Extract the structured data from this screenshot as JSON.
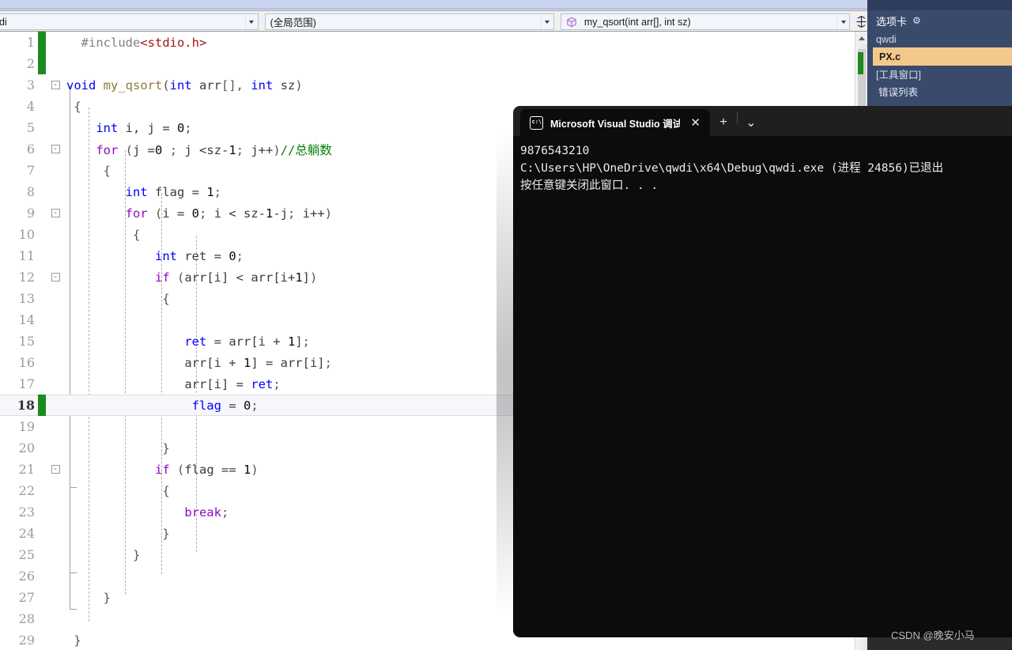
{
  "navbar": {
    "project_combo": {
      "value": "di",
      "arrow_icon": "chevron-down-icon"
    },
    "scope_combo": {
      "value": "(全局范围)",
      "arrow_icon": "chevron-down-icon"
    },
    "member_combo": {
      "value": "my_qsort(int arr[], int sz)",
      "icon": "cube-icon",
      "arrow_icon": "chevron-down-icon"
    },
    "splitter_icon": "split-window-icon"
  },
  "editor": {
    "current_line": 18,
    "lines": [
      {
        "n": "1",
        "fold": "",
        "change": "green",
        "html": "  <span class='pp'>#include</span><span class='str'>&lt;stdio.h&gt;</span>"
      },
      {
        "n": "2",
        "fold": "",
        "change": "green",
        "html": ""
      },
      {
        "n": "3",
        "fold": "-",
        "change": "",
        "html": "<span class='kw'>void</span> <span class='fn'>my_qsort</span><span class='punc'>(</span><span class='kw'>int</span> <span class='plain'>arr</span><span class='punc'>[], </span><span class='kw'>int</span> <span class='plain'>sz</span><span class='punc'>)</span>"
      },
      {
        "n": "4",
        "fold": "",
        "change": "",
        "html": " <span class='punc'>{</span>"
      },
      {
        "n": "5",
        "fold": "",
        "change": "",
        "html": "    <span class='kw'>int</span> <span class='plain'>i, j = </span><span class='num'>0</span><span class='punc'>;</span>"
      },
      {
        "n": "6",
        "fold": "-",
        "change": "",
        "html": "    <span class='kw2'>for</span> <span class='punc'>(</span><span class='plain'>j =</span><span class='num'>0</span> <span class='punc'>; </span><span class='plain'>j &lt;sz-</span><span class='num'>1</span><span class='punc'>; </span><span class='plain'>j++</span><span class='punc'>)</span><span class='cmt'>//总躺数</span>"
      },
      {
        "n": "7",
        "fold": "",
        "change": "",
        "html": "     <span class='punc'>{</span>"
      },
      {
        "n": "8",
        "fold": "",
        "change": "",
        "html": "        <span class='kw'>int</span> <span class='plain'>flag = </span><span class='num'>1</span><span class='punc'>;</span>"
      },
      {
        "n": "9",
        "fold": "-",
        "change": "",
        "html": "        <span class='kw2'>for</span> <span class='punc'>(</span><span class='plain'>i = </span><span class='num'>0</span><span class='punc'>; </span><span class='plain'>i &lt; sz-</span><span class='num'>1</span><span class='plain'>-j</span><span class='punc'>; </span><span class='plain'>i++</span><span class='punc'>)</span>"
      },
      {
        "n": "10",
        "fold": "",
        "change": "",
        "html": "         <span class='punc'>{</span>"
      },
      {
        "n": "11",
        "fold": "",
        "change": "",
        "html": "            <span class='kw'>int</span> <span class='plain'>ret = </span><span class='num'>0</span><span class='punc'>;</span>"
      },
      {
        "n": "12",
        "fold": "-",
        "change": "",
        "html": "            <span class='kw2'>if</span> <span class='punc'>(</span><span class='plain'>arr[i] &lt; arr[i+</span><span class='num'>1</span><span class='plain'>]</span><span class='punc'>)</span>"
      },
      {
        "n": "13",
        "fold": "",
        "change": "",
        "html": "             <span class='punc'>{</span>"
      },
      {
        "n": "14",
        "fold": "",
        "change": "",
        "html": ""
      },
      {
        "n": "15",
        "fold": "",
        "change": "",
        "html": "                <span class='kw'>ret</span> <span class='plain'>= arr[i + </span><span class='num'>1</span><span class='plain'>]</span><span class='punc'>;</span>"
      },
      {
        "n": "16",
        "fold": "",
        "change": "",
        "html": "                <span class='plain'>arr[i + </span><span class='num'>1</span><span class='plain'>] = arr[i]</span><span class='punc'>;</span>"
      },
      {
        "n": "17",
        "fold": "",
        "change": "",
        "html": "                <span class='plain'>arr[i] = </span><span class='kw'>ret</span><span class='punc'>;</span>"
      },
      {
        "n": "18",
        "fold": "",
        "change": "green",
        "html": "                 <span class='kw'>flag</span> <span class='plain'>= </span><span class='num'>0</span><span class='punc'>;</span>"
      },
      {
        "n": "19",
        "fold": "",
        "change": "",
        "html": ""
      },
      {
        "n": "20",
        "fold": "",
        "change": "",
        "html": "             <span class='punc'>}</span>"
      },
      {
        "n": "21",
        "fold": "-",
        "change": "",
        "html": "            <span class='kw2'>if</span> <span class='punc'>(</span><span class='plain'>flag == </span><span class='num'>1</span><span class='punc'>)</span>"
      },
      {
        "n": "22",
        "fold": "",
        "change": "",
        "html": "             <span class='punc'>{</span>"
      },
      {
        "n": "23",
        "fold": "",
        "change": "",
        "html": "                <span class='kw2'>break</span><span class='punc'>;</span>"
      },
      {
        "n": "24",
        "fold": "",
        "change": "",
        "html": "             <span class='punc'>}</span>"
      },
      {
        "n": "25",
        "fold": "",
        "change": "",
        "html": "         <span class='punc'>}</span>"
      },
      {
        "n": "26",
        "fold": "",
        "change": "",
        "html": ""
      },
      {
        "n": "27",
        "fold": "",
        "change": "",
        "html": "     <span class='punc'>}</span>"
      },
      {
        "n": "28",
        "fold": "",
        "change": "",
        "html": ""
      },
      {
        "n": "29",
        "fold": "",
        "change": "",
        "html": " <span class='punc'>}</span>"
      }
    ]
  },
  "scrollbar": {
    "up_arrow_icon": "caret-up-icon",
    "marker_color": "#1e8a1e",
    "thumb_color": "#cfcfcf"
  },
  "tabs_panel": {
    "title": "选项卡",
    "gear_icon": "gear-icon",
    "groups": [
      {
        "label": "qwdi",
        "items": [
          {
            "label": "PX.c",
            "active": true
          }
        ]
      },
      {
        "label": "[工具窗口]",
        "items": [
          {
            "label": "错误列表",
            "active": false
          }
        ]
      }
    ],
    "group1_label": "qwdi",
    "group1_item": "PX.c",
    "group2_label": "[工具窗口]",
    "group2_item": "错误列表",
    "accent_color": "#f3c98b",
    "background_color": "#3a4a6b"
  },
  "console": {
    "tab_title": "Microsoft Visual Studio 调试控",
    "tab_icon": "command-prompt-icon",
    "close_icon": "close-icon",
    "new_tab_icon": "plus-icon",
    "dropdown_icon": "chevron-down-icon",
    "output_lines": [
      "9876543210",
      "C:\\Users\\HP\\OneDrive\\qwdi\\x64\\Debug\\qwdi.exe (进程 24856)已退出",
      "按任意键关闭此窗口. . ."
    ],
    "output_text": "9876543210\nC:\\Users\\HP\\OneDrive\\qwdi\\x64\\Debug\\qwdi.exe (进程 24856)已退出\n按任意键关闭此窗口. . .",
    "background_color": "#0c0c0c"
  },
  "watermark": {
    "text": "CSDN @晚安小马"
  }
}
